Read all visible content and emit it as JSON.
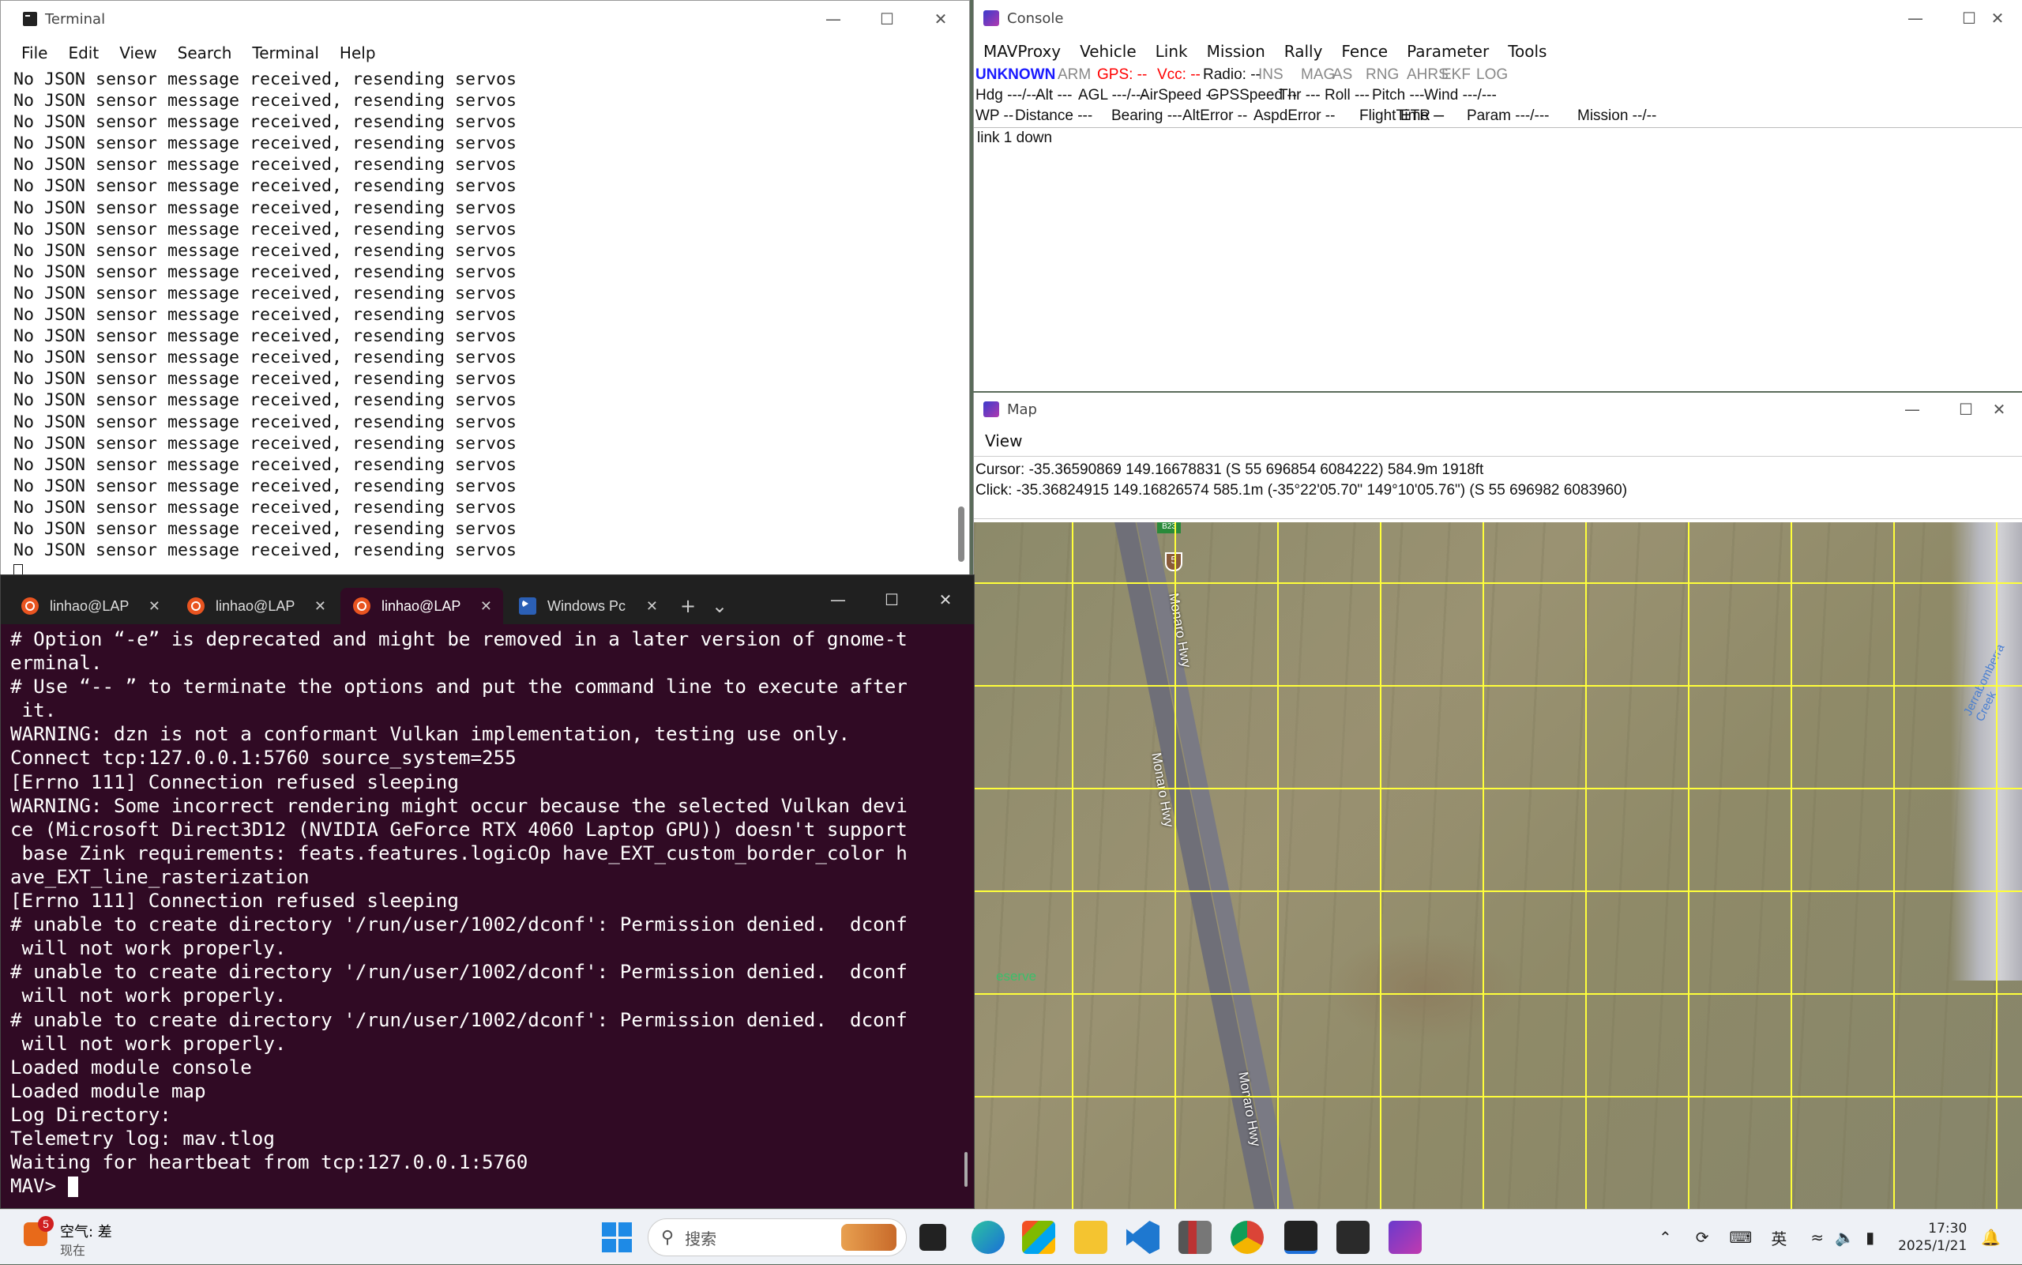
{
  "terminal": {
    "title": "Terminal",
    "menu": [
      "File",
      "Edit",
      "View",
      "Search",
      "Terminal",
      "Help"
    ],
    "line": "No JSON sensor message received, resending servos",
    "line_count": 23
  },
  "console": {
    "title": "Console",
    "menu": [
      "MAVProxy",
      "Vehicle",
      "Link",
      "Mission",
      "Rally",
      "Fence",
      "Parameter",
      "Tools"
    ],
    "row1": [
      "UNKNOWN",
      "ARM",
      "GPS: --",
      "Vcc: --",
      "Radio: --",
      "INS",
      "MAG",
      "AS",
      "RNG",
      "AHRS",
      "EKF",
      "LOG"
    ],
    "row2": [
      "Hdg ---/---",
      "Alt ---",
      "AGL ---/---",
      "AirSpeed --",
      "GPSSpeed --",
      "Thr ---",
      "Roll ---",
      "Pitch ---",
      "Wind ---/---"
    ],
    "row3": [
      "WP --",
      "Distance ---",
      "Bearing ---",
      "AltError --",
      "AspdError --",
      "FlightTime --",
      "ETR --",
      "Param ---/---",
      "Mission --/--"
    ],
    "log": "link 1 down",
    "colors": {
      "unknown": "#1a1aff",
      "gps": "#ff0000",
      "vcc": "#ff0000",
      "grey": "#888888"
    }
  },
  "map": {
    "title": "Map",
    "menu": [
      "View"
    ],
    "cursor": "Cursor: -35.36590869 149.16678831 (S 55 696854 6084222) 584.9m 1918ft",
    "click": "Click: -35.36824915 149.16826574  585.1m (-35°22'05.70\" 149°10'05.76\") (S 55 696982 6083960)",
    "road_label": "Monaro Hwy",
    "reserve_label": "eserve",
    "river_label": "Jerrabomberra Creek",
    "shield": "5",
    "sign": "B23",
    "grid_color": "#ffff3a"
  },
  "wt": {
    "tabs": [
      {
        "label": "linhao@LAP",
        "icon": "ubuntu-icon"
      },
      {
        "label": "linhao@LAP",
        "icon": "ubuntu-icon"
      },
      {
        "label": "linhao@LAP",
        "icon": "ubuntu-icon",
        "active": true
      },
      {
        "label": "Windows Pc",
        "icon": "powershell-icon"
      }
    ],
    "lines": [
      "# Option “-e” is deprecated and might be removed in a later version of gnome-t",
      "erminal.",
      "# Use “-- ” to terminate the options and put the command line to execute after",
      " it.",
      "WARNING: dzn is not a conformant Vulkan implementation, testing use only.",
      "Connect tcp:127.0.0.1:5760 source_system=255",
      "[Errno 111] Connection refused sleeping",
      "WARNING: Some incorrect rendering might occur because the selected Vulkan devi",
      "ce (Microsoft Direct3D12 (NVIDIA GeForce RTX 4060 Laptop GPU)) doesn't support",
      " base Zink requirements: feats.features.logicOp have_EXT_custom_border_color h",
      "ave_EXT_line_rasterization",
      "[Errno 111] Connection refused sleeping",
      "# unable to create directory '/run/user/1002/dconf': Permission denied.  dconf",
      " will not work properly.",
      "# unable to create directory '/run/user/1002/dconf': Permission denied.  dconf",
      " will not work properly.",
      "# unable to create directory '/run/user/1002/dconf': Permission denied.  dconf",
      " will not work properly.",
      "Loaded module console",
      "Loaded module map",
      "Log Directory:",
      "Telemetry log: mav.tlog",
      "Waiting for heartbeat from tcp:127.0.0.1:5760"
    ],
    "prompt": "MAV> "
  },
  "taskbar": {
    "weather_title": "空气: 差",
    "weather_sub": "现在",
    "weather_badge": "5",
    "search_placeholder": "搜索",
    "ime": "英",
    "time": "17:30",
    "date": "2025/1/21"
  }
}
